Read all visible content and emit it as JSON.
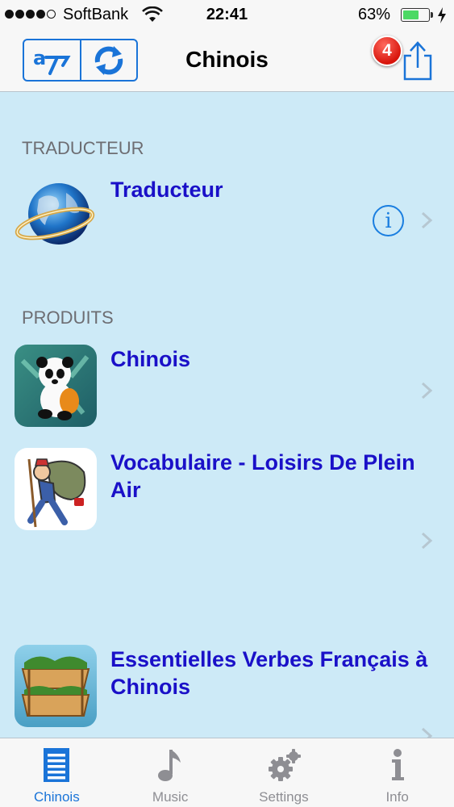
{
  "status_bar": {
    "carrier": "SoftBank",
    "time": "22:41",
    "battery": "63%",
    "battery_level": 0.63
  },
  "nav": {
    "title": "Chinois",
    "share_badge": "4",
    "translate_icon": "translate-icon",
    "refresh_icon": "refresh-icon",
    "share_icon": "share-icon"
  },
  "sections": [
    {
      "header": "TRADUCTEUR",
      "rows": [
        {
          "title": "Traducteur",
          "icon": "globe-icon"
        }
      ]
    },
    {
      "header": "PRODUITS",
      "rows": [
        {
          "title": "Chinois",
          "icon": "panda-icon"
        },
        {
          "title": "Vocabulaire - Loisirs De Plein Air",
          "icon": "hiker-icon"
        },
        {
          "title": "Essentielles Verbes Français à Chinois",
          "icon": "crate-icon"
        }
      ]
    }
  ],
  "tabs": [
    {
      "label": "Chinois",
      "icon": "list-icon",
      "active": true
    },
    {
      "label": "Music",
      "icon": "music-note-icon",
      "active": false
    },
    {
      "label": "Settings",
      "icon": "gear-icon",
      "active": false
    },
    {
      "label": "Info",
      "icon": "info-icon",
      "active": false
    }
  ],
  "colors": {
    "accent": "#1a74d8",
    "row_title": "#1a10c8",
    "content_background": "#cdeaf7",
    "badge": "#d8150c"
  }
}
